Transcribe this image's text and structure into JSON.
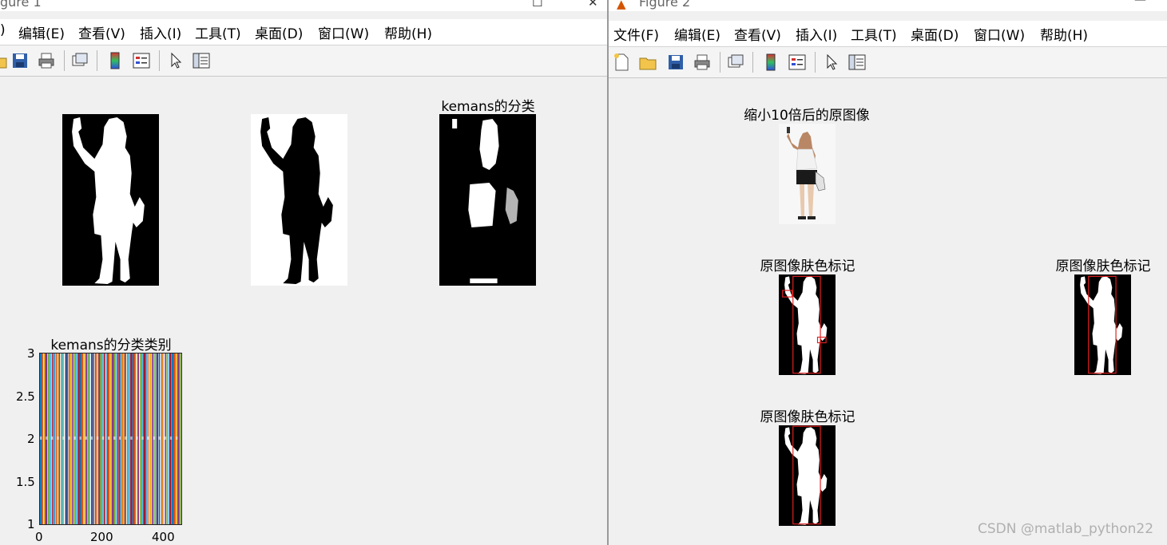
{
  "figure1": {
    "title": "gure 1",
    "menu": [
      ")",
      "编辑(E)",
      "查看(V)",
      "插入(I)",
      "工具(T)",
      "桌面(D)",
      "窗口(W)",
      "帮助(H)"
    ],
    "plot3_title": "kemans的分类",
    "plot4_title": "kemans的分类类别"
  },
  "figure2": {
    "title": "Figure 2",
    "menu": [
      "文件(F)",
      "编辑(E)",
      "查看(V)",
      "插入(I)",
      "工具(T)",
      "桌面(D)",
      "窗口(W)",
      "帮助(H)"
    ],
    "plot1_title": "缩小10倍后的原图像",
    "plot2_title": "原图像肤色标记",
    "plot3_title": "原图像肤色标记",
    "plot4_title": "原图像肤色标记"
  },
  "chart_data": {
    "type": "line",
    "title": "kemans的分类类别",
    "xlim": [
      0,
      450
    ],
    "ylim": [
      1,
      3
    ],
    "xticks": [
      "0",
      "200",
      "400"
    ],
    "yticks": [
      "1",
      "1.5",
      "2",
      "2.5",
      "3"
    ],
    "series_count": 75,
    "colors": [
      "#0072BD",
      "#D95319",
      "#EDB120",
      "#7E2F8E",
      "#77AC30",
      "#4DBEEE",
      "#A2142F"
    ]
  },
  "watermark": "CSDN @matlab_python22"
}
